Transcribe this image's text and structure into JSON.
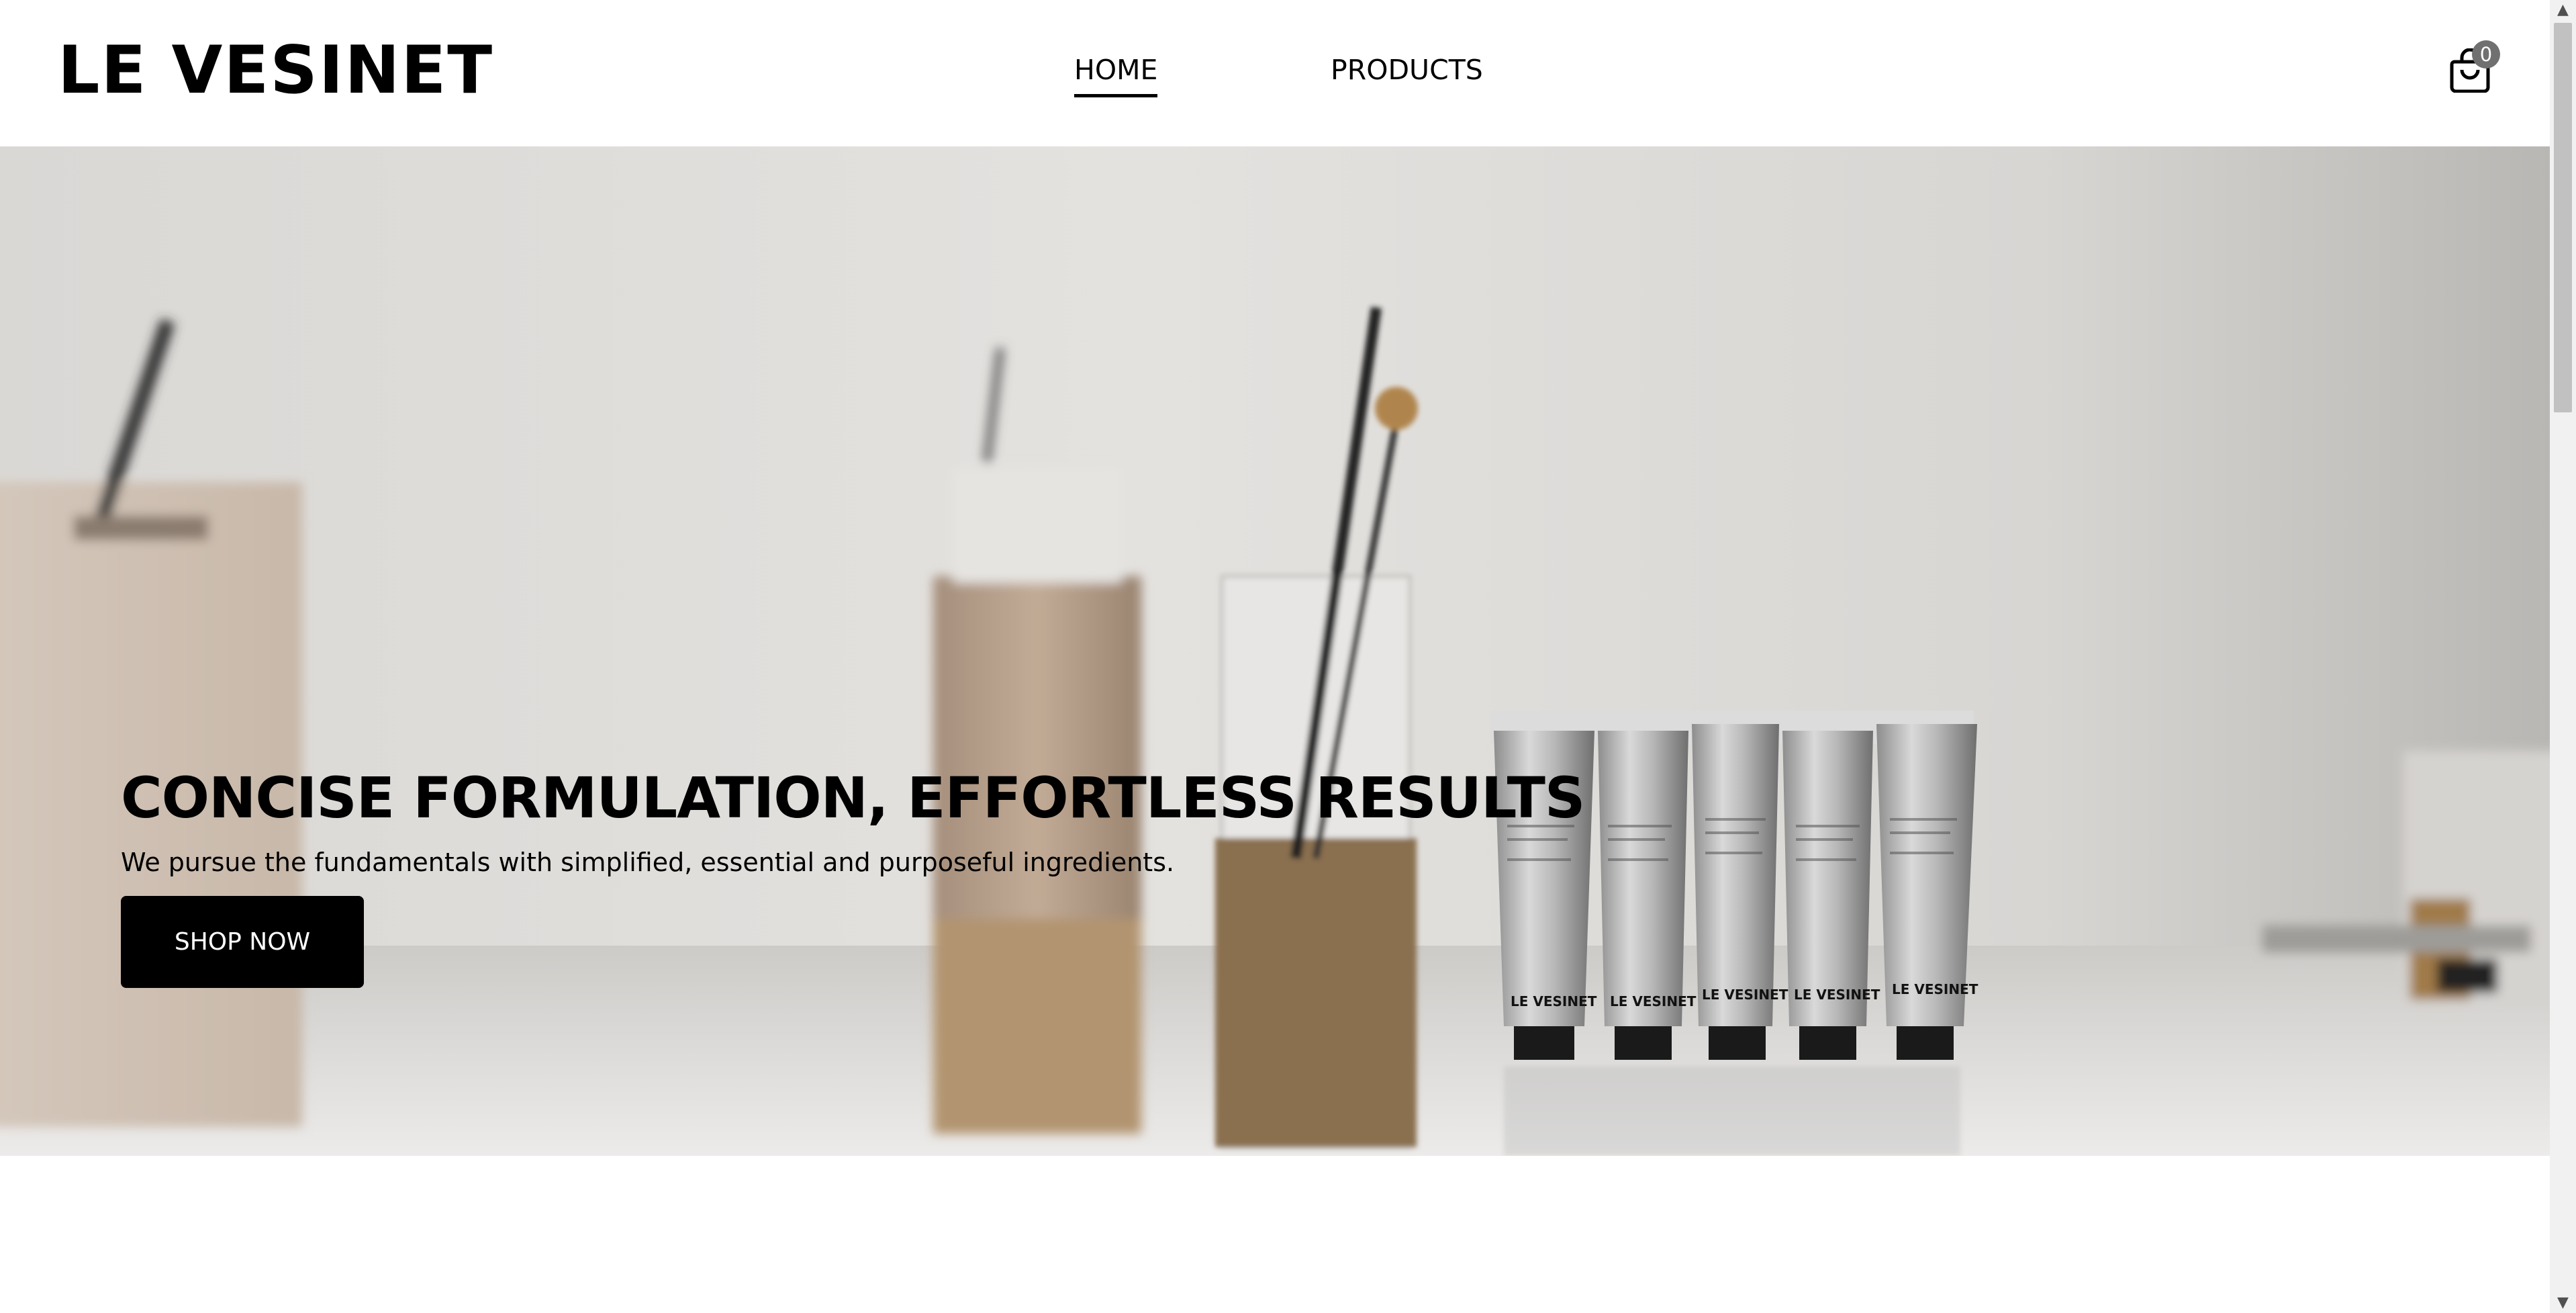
{
  "header": {
    "logo": "LE VESINET",
    "nav": {
      "home": "HOME",
      "products": "PRODUCTS"
    },
    "cart": {
      "icon": "shopping-bag-icon",
      "count": "0"
    }
  },
  "hero": {
    "title": "CONCISE FORMULATION, EFFORTLESS RESULTS",
    "subtitle": "We pursue the fundamentals with simplified, essential and purposeful ingredients.",
    "cta_label": "SHOP NOW",
    "tube_brand": "LE VESINET"
  },
  "colors": {
    "accent": "#000000",
    "background": "#ffffff",
    "badge": "#707070"
  },
  "scrollbar": {
    "up_icon": "scroll-up-arrow-icon",
    "down_icon": "scroll-down-arrow-icon"
  }
}
